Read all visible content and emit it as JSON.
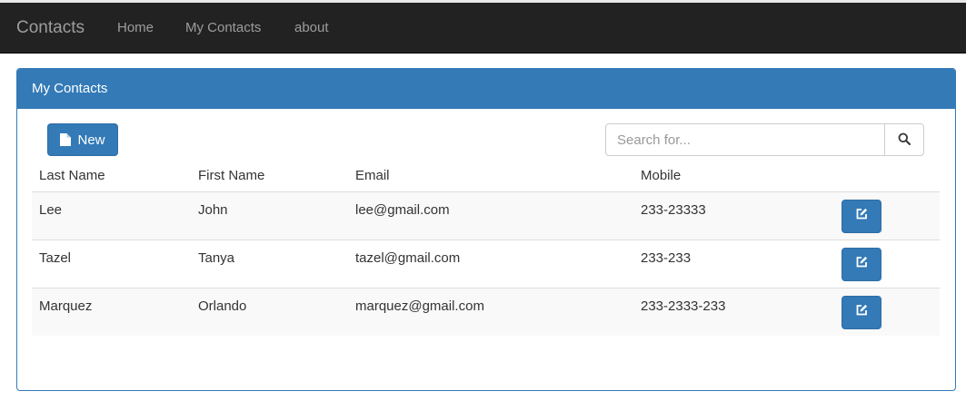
{
  "navbar": {
    "brand": "Contacts",
    "links": [
      "Home",
      "My Contacts",
      "about"
    ]
  },
  "panel": {
    "title": "My Contacts",
    "new_button_label": "New",
    "new_button_icon": "file-icon",
    "search": {
      "placeholder": "Search for...",
      "value": "",
      "icon": "search-icon"
    }
  },
  "table": {
    "headers": [
      "Last Name",
      "First Name",
      "Email",
      "Mobile"
    ],
    "rows": [
      {
        "last_name": "Lee",
        "first_name": "John",
        "email": "lee@gmail.com",
        "mobile": "233-23333"
      },
      {
        "last_name": "Tazel",
        "first_name": "Tanya",
        "email": "tazel@gmail.com",
        "mobile": "233-233"
      },
      {
        "last_name": "Marquez",
        "first_name": "Orlando",
        "email": "marquez@gmail.com",
        "mobile": "233-2333-233"
      }
    ],
    "row_action_icon": "edit-icon"
  },
  "colors": {
    "navbar_bg": "#222222",
    "nav_text": "#9d9d9d",
    "primary": "#337ab7",
    "striped_row": "#f9f9f9"
  }
}
